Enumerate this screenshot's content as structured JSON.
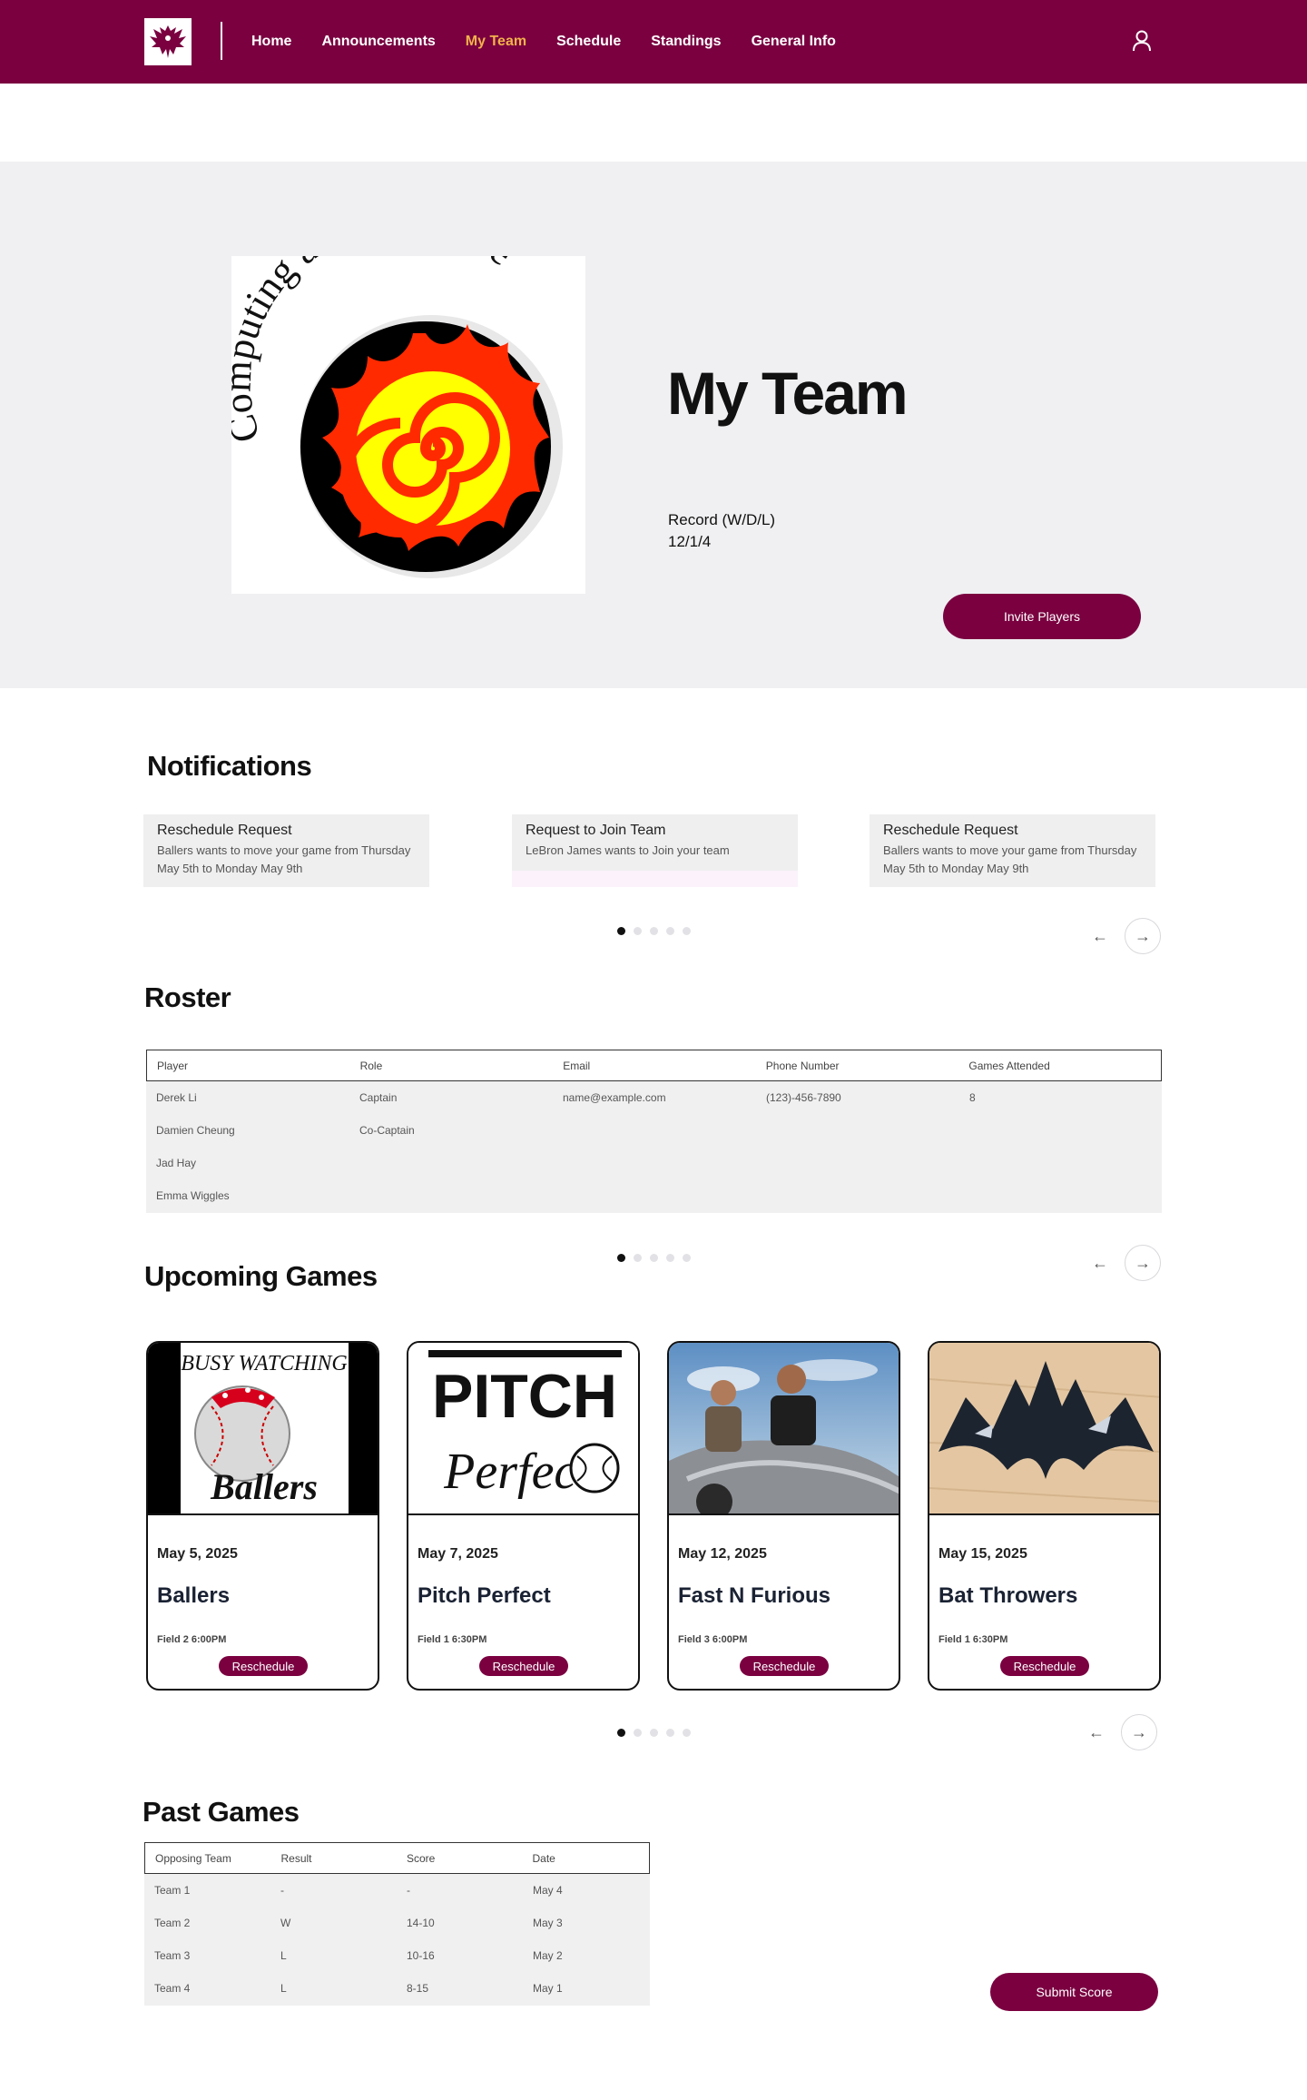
{
  "nav": {
    "links": [
      "Home",
      "Announcements",
      "My Team",
      "Schedule",
      "Standings",
      "General Info"
    ],
    "active": "My Team"
  },
  "hero": {
    "logo_text": "Computing and Software",
    "title": "My Team",
    "record_label": "Record (W/D/L)",
    "record_value": "12/1/4",
    "invite_label": "Invite Players"
  },
  "notifications": {
    "title": "Notifications",
    "items": [
      {
        "title": "Reschedule Request",
        "body": "Ballers wants to move your game from Thursday May 5th to Monday May 9th"
      },
      {
        "title": "Request to Join Team",
        "body": "LeBron James wants to Join your team"
      },
      {
        "title": "Reschedule Request",
        "body": "Ballers wants to move your game from Thursday May 5th to Monday May 9th"
      }
    ]
  },
  "roster": {
    "title": "Roster",
    "columns": [
      "Player",
      "Role",
      "Email",
      "Phone Number",
      "Games Attended"
    ],
    "rows": [
      [
        "Derek Li",
        "Captain",
        "name@example.com",
        "(123)-456-7890",
        "8"
      ],
      [
        "Damien Cheung",
        "Co-Captain",
        "",
        "",
        ""
      ],
      [
        "Jad Hay",
        "",
        "",
        "",
        ""
      ],
      [
        "Emma Wiggles",
        "",
        "",
        "",
        ""
      ]
    ]
  },
  "upcoming": {
    "title": "Upcoming Games",
    "games": [
      {
        "date": "May 5, 2025",
        "name": "Ballers",
        "field": "Field 2 6:00PM",
        "button": "Reschedule",
        "img_text": "Ballers",
        "img_top": "BUSY WATCHING"
      },
      {
        "date": "May 7, 2025",
        "name": "Pitch Perfect",
        "field": "Field 1 6:30PM",
        "button": "Reschedule",
        "img_text": "Perfect",
        "img_top": "PITCH"
      },
      {
        "date": "May 12, 2025",
        "name": "Fast N Furious",
        "field": "Field 3 6:00PM",
        "button": "Reschedule"
      },
      {
        "date": "May 15, 2025",
        "name": "Bat Throwers",
        "field": "Field 1 6:30PM",
        "button": "Reschedule"
      }
    ]
  },
  "past": {
    "title": "Past Games",
    "columns": [
      "Opposing Team",
      "Result",
      "Score",
      "Date"
    ],
    "rows": [
      [
        "Team 1",
        "-",
        "-",
        "May 4"
      ],
      [
        "Team 2",
        "W",
        "14-10",
        "May 3"
      ],
      [
        "Team 3",
        "L",
        "10-16",
        "May 2"
      ],
      [
        "Team 4",
        "L",
        "8-15",
        "May 1"
      ]
    ],
    "submit_label": "Submit Score"
  },
  "carousel": {
    "prev": "←",
    "next": "→"
  },
  "colors": {
    "brand": "#7a0040",
    "nav_active": "#f2b14c",
    "hero_bg": "#f0f0f2"
  }
}
